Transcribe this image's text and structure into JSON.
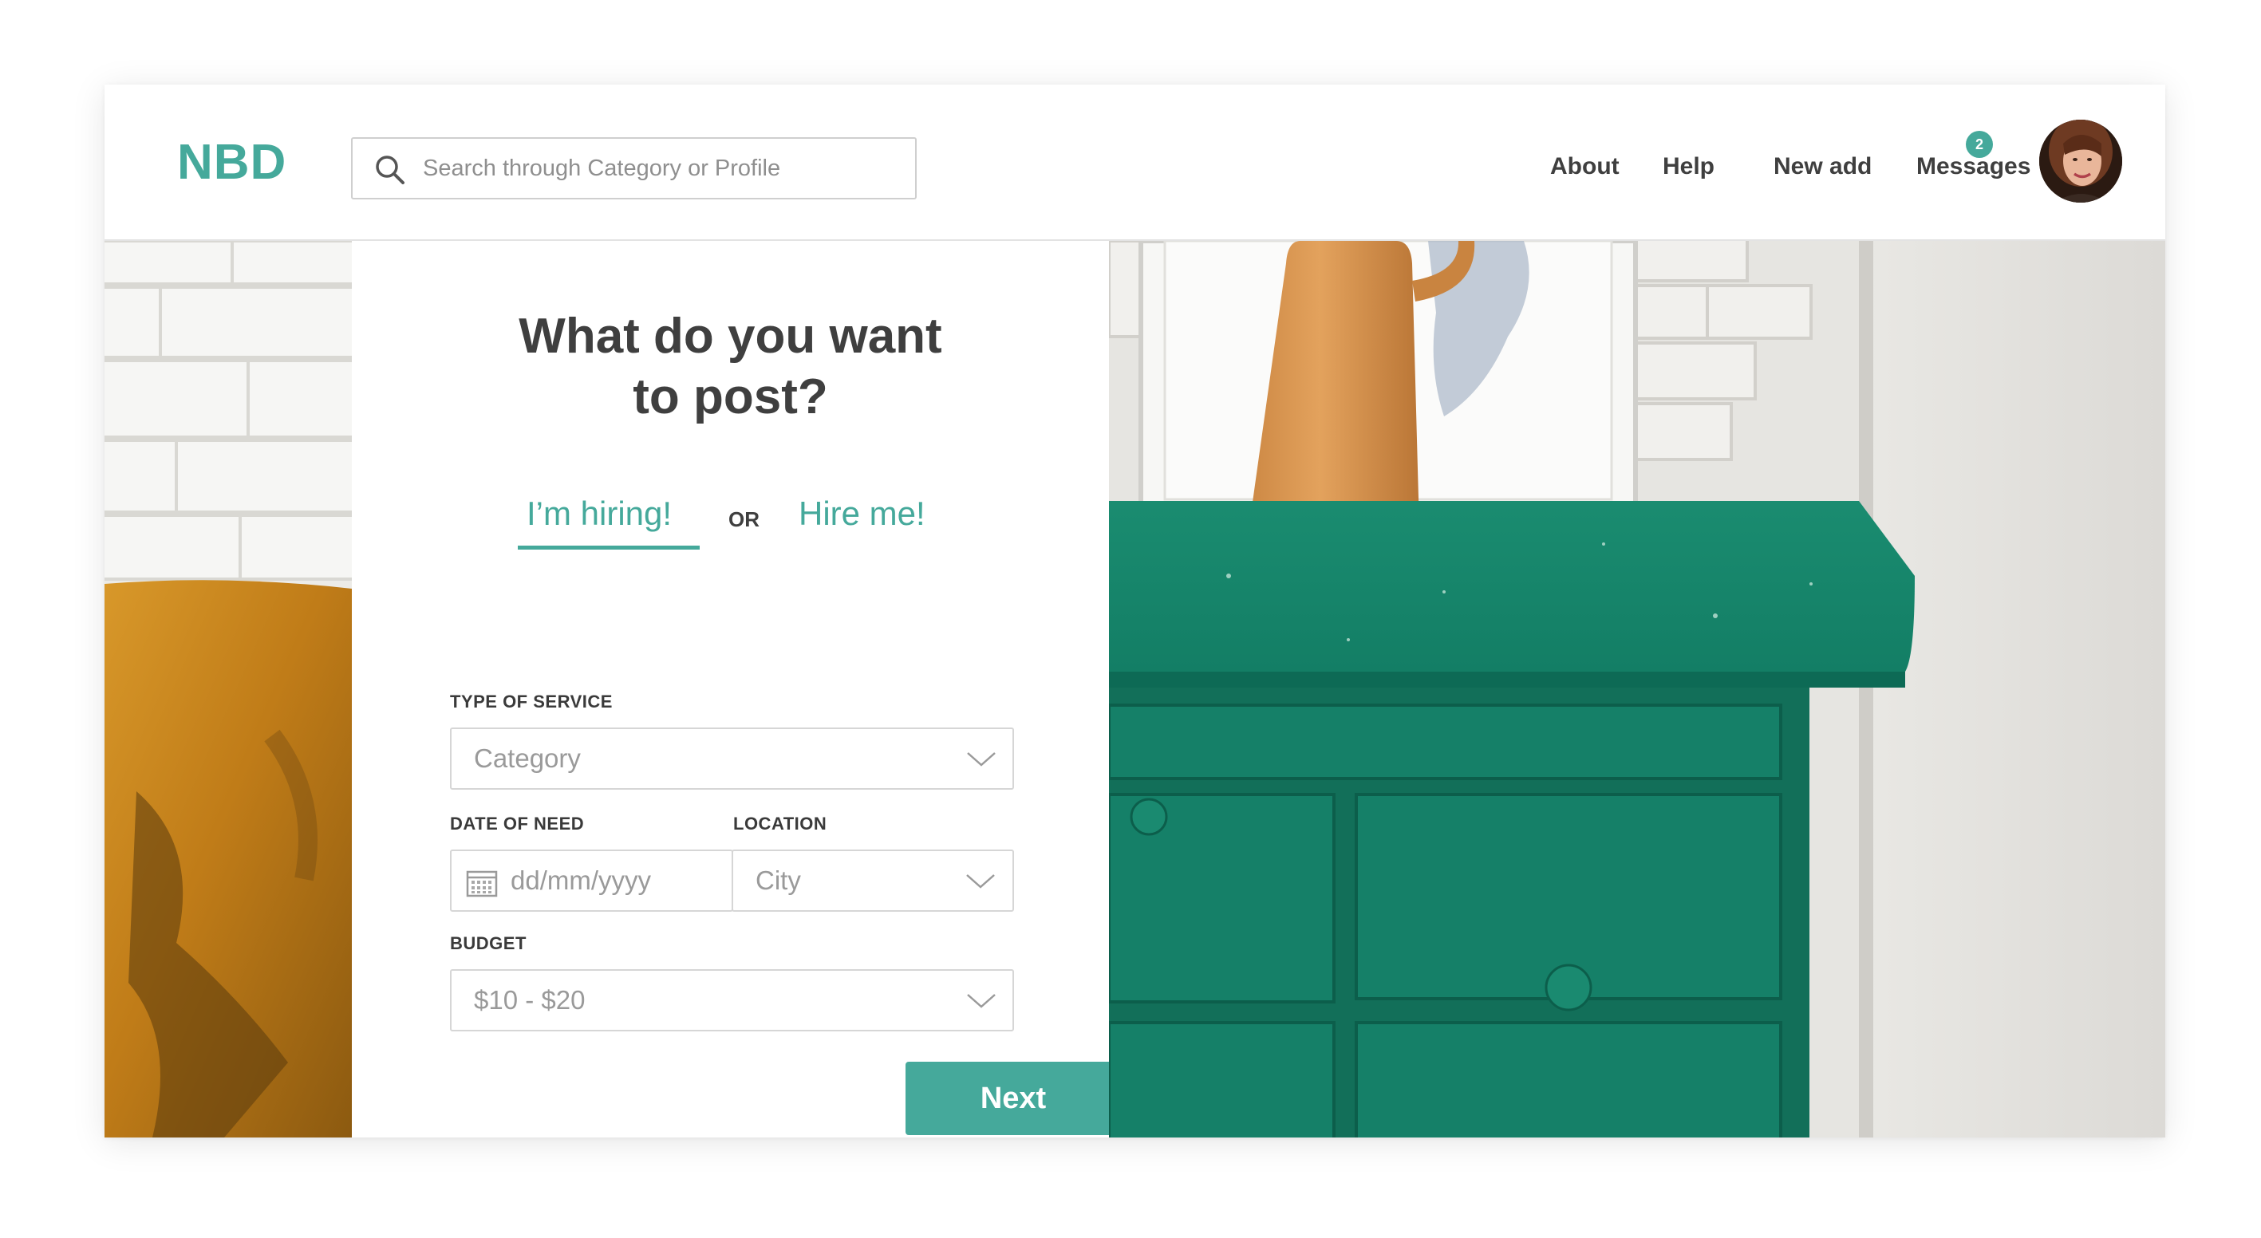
{
  "header": {
    "logo": "NBD",
    "search": {
      "placeholder": "Search through Category or Profile"
    },
    "nav": [
      {
        "label": "About"
      },
      {
        "label": "Help"
      },
      {
        "label": "New add"
      },
      {
        "label": "Messages"
      }
    ],
    "messages_badge": "2"
  },
  "form": {
    "title_line1": "What do you want",
    "title_line2": "to post?",
    "tabs": {
      "hiring": "I’m hiring!",
      "or": "OR",
      "hire_me": "Hire me!",
      "active": "hiring"
    },
    "type_of_service": {
      "label": "TYPE OF SERVICE",
      "value": "Category"
    },
    "date_of_need": {
      "label": "DATE OF NEED",
      "placeholder": "dd/mm/yyyy"
    },
    "location": {
      "label": "LOCATION",
      "value": "City"
    },
    "budget": {
      "label": "BUDGET",
      "value": "$10 - $20"
    },
    "next_button": "Next"
  },
  "colors": {
    "accent": "#45a99b",
    "text_dark": "#3f3f3f",
    "cabinet_green": "#137e65",
    "vase_orange": "#d9944f",
    "pillow_mustard": "#c9861e"
  }
}
